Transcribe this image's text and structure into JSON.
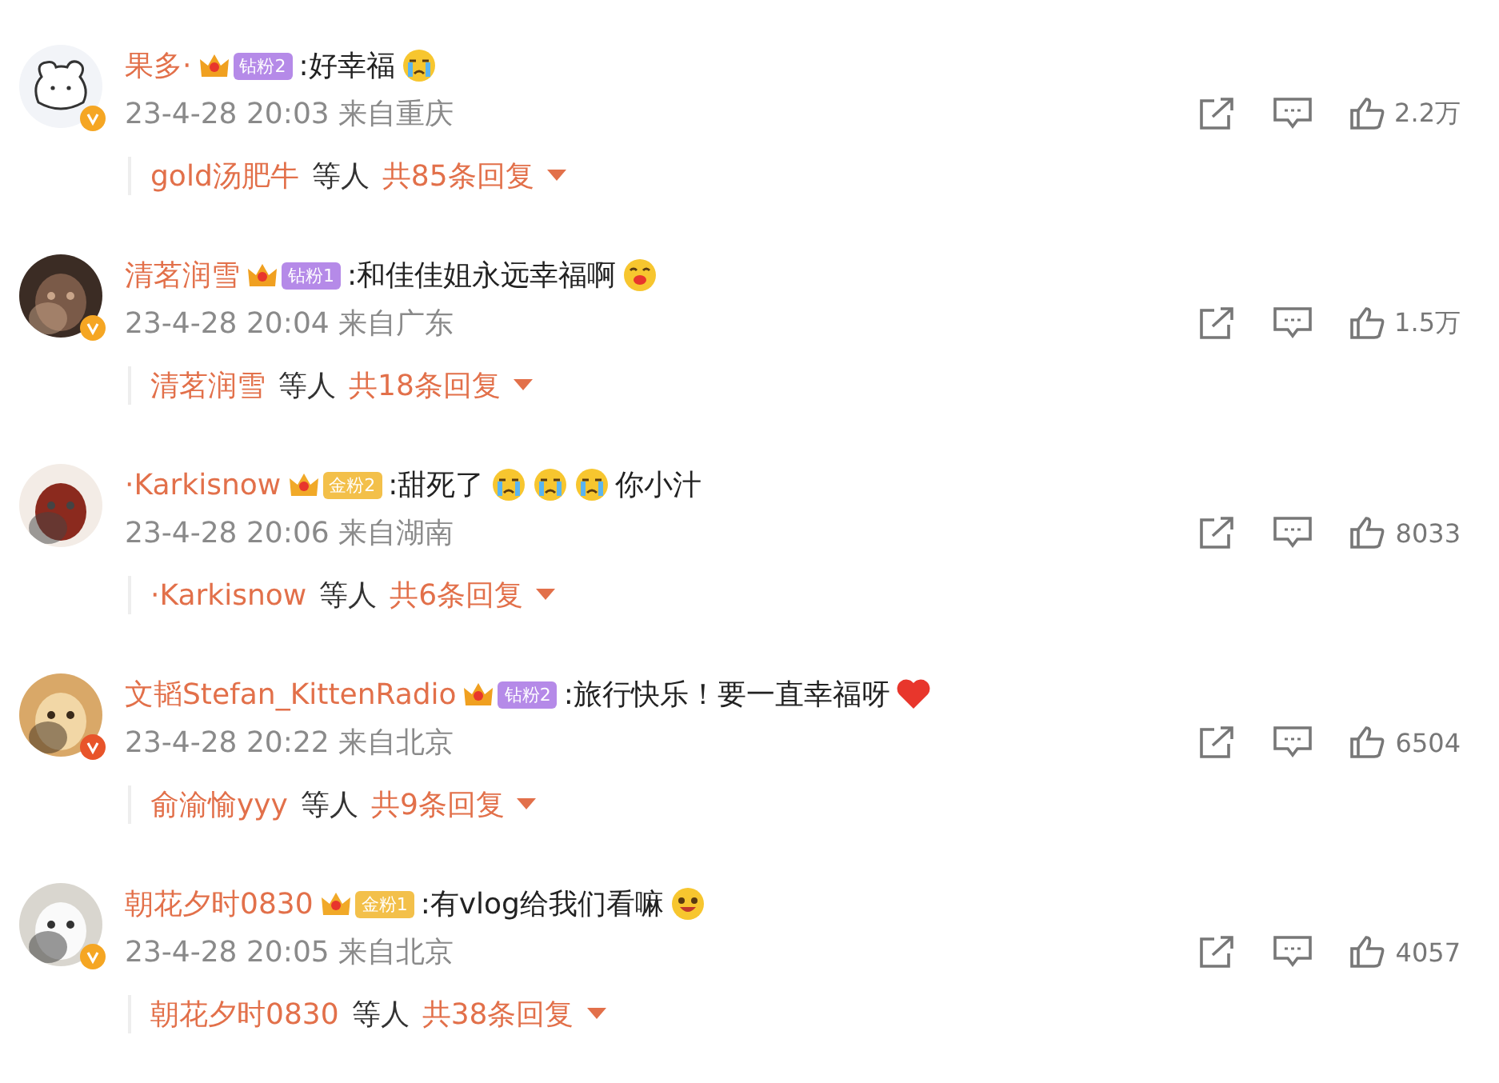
{
  "comments": [
    {
      "avatar": {
        "kind": "bear"
      },
      "verified": {
        "color": "#f5a623"
      },
      "name": "果多·",
      "badge": {
        "kind": "diamond",
        "label": "钻粉2"
      },
      "content": [
        {
          "kind": "text",
          "text": ":好幸福"
        },
        {
          "kind": "cry"
        }
      ],
      "meta": "23-4-28 20:03 来自重庆",
      "likes": "2.2万",
      "replies": {
        "user": "gold汤肥牛",
        "others": "等人",
        "total": "共85条回复"
      }
    },
    {
      "verified": {
        "color": "#f5a623"
      },
      "name": "清茗润雪",
      "badge": {
        "kind": "diamond",
        "label": "钻粉1"
      },
      "content": [
        {
          "kind": "text",
          "text": ":和佳佳姐永远幸福啊"
        },
        {
          "kind": "kiss"
        }
      ],
      "meta": "23-4-28 20:04 来自广东",
      "likes": "1.5万",
      "replies": {
        "user": "清茗润雪",
        "others": "等人",
        "total": "共18条回复"
      }
    },
    {
      "name": "·Karkisnow",
      "badge": {
        "kind": "gold",
        "label": "金粉2"
      },
      "content": [
        {
          "kind": "text",
          "text": ":甜死了"
        },
        {
          "kind": "cry"
        },
        {
          "kind": "cry"
        },
        {
          "kind": "cry"
        },
        {
          "kind": "text",
          "text": "你小汁"
        }
      ],
      "meta": "23-4-28 20:06 来自湖南",
      "likes": "8033",
      "replies": {
        "user": "·Karkisnow",
        "others": "等人",
        "total": "共6条回复"
      }
    },
    {
      "verified": {
        "color": "#e8542a"
      },
      "name": "文韬Stefan_KittenRadio",
      "badge": {
        "kind": "diamond",
        "label": "钻粉2"
      },
      "content": [
        {
          "kind": "text",
          "text": ":旅行快乐！要一直幸福呀"
        },
        {
          "kind": "heart"
        }
      ],
      "meta": "23-4-28 20:22 来自北京",
      "likes": "6504",
      "replies": {
        "user": "俞渝愉yyy",
        "others": "等人",
        "total": "共9条回复"
      }
    },
    {
      "verified": {
        "color": "#f5a623"
      },
      "name": "朝花夕时0830",
      "badge": {
        "kind": "gold",
        "label": "金粉1"
      },
      "content": [
        {
          "kind": "text",
          "text": ":有vlog给我们看嘛"
        },
        {
          "kind": "happy"
        }
      ],
      "meta": "23-4-28 20:05 来自北京",
      "likes": "4057",
      "replies": {
        "user": "朝花夕时0830",
        "others": "等人",
        "total": "共38条回复"
      }
    }
  ]
}
